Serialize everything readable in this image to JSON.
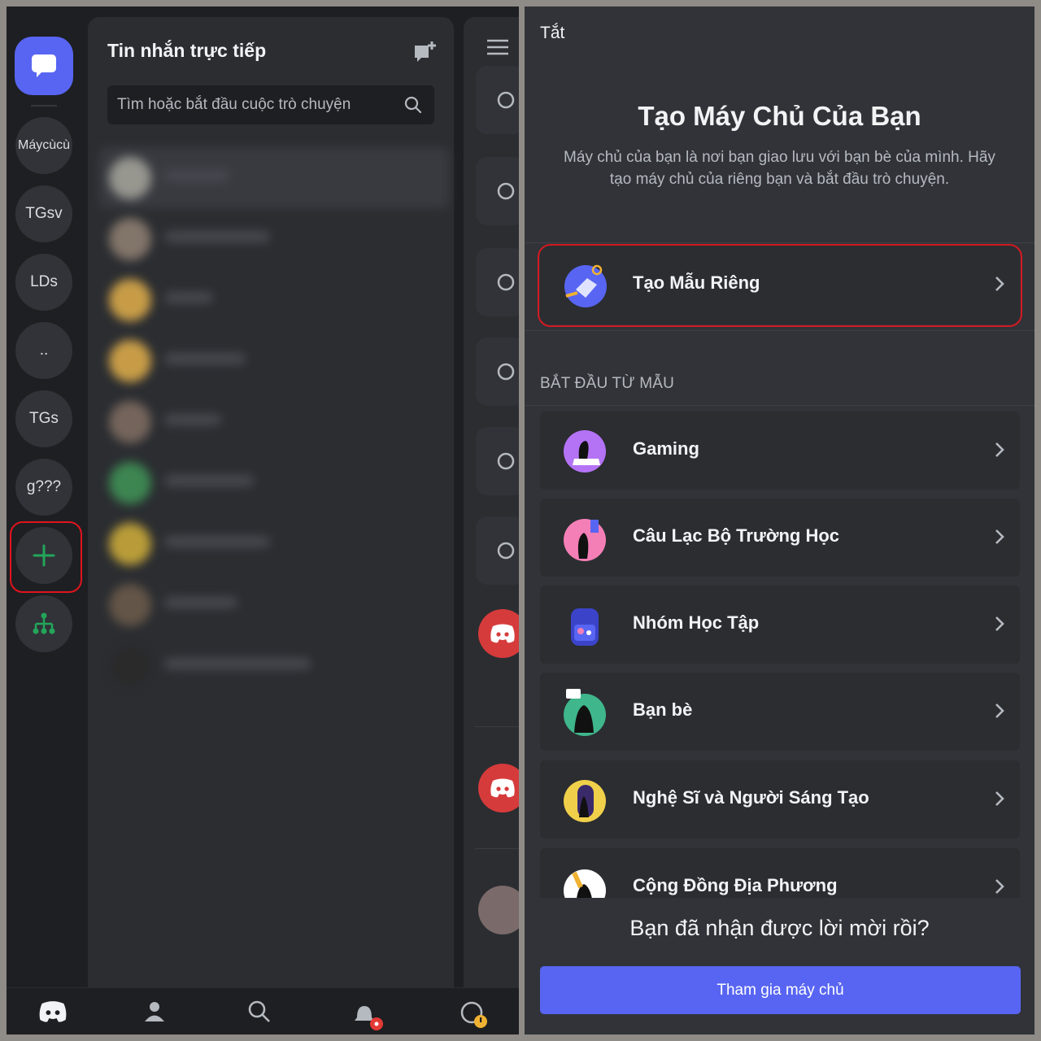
{
  "left": {
    "servers": [
      "Máycùcù",
      "TGsv",
      "LDs",
      "..",
      "TGs",
      "g???"
    ],
    "dm_title": "Tin nhắn trực tiếp",
    "search_placeholder": "Tìm hoặc bắt đầu cuộc trò chuyện",
    "dm_rows_count_note": "blurred"
  },
  "right": {
    "close_label": "Tắt",
    "title": "Tạo Máy Chủ Của Bạn",
    "subtitle": "Máy chủ của bạn là nơi bạn giao lưu với bạn bè của mình. Hãy tạo máy chủ của riêng bạn và bắt đầu trò chuyện.",
    "own_template": "Tạo Mẫu Riêng",
    "section_header": "BẮT ĐẦU TỪ MẪU",
    "templates": [
      {
        "label": "Gaming",
        "icon": "gaming-icon"
      },
      {
        "label": "Câu Lạc Bộ Trường Học",
        "icon": "school-club-icon"
      },
      {
        "label": "Nhóm Học Tập",
        "icon": "study-group-icon"
      },
      {
        "label": "Bạn bè",
        "icon": "friends-icon"
      },
      {
        "label": "Nghệ Sĩ và Người Sáng Tạo",
        "icon": "artists-creators-icon"
      },
      {
        "label": "Cộng Đồng Địa Phương",
        "icon": "local-community-icon"
      }
    ],
    "invite_question": "Bạn đã nhận được lời mời rồi?",
    "join_button": "Tham gia máy chủ"
  },
  "colors": {
    "blurple": "#5865f2",
    "highlight_red": "#e0141e",
    "add_green": "#23a55a"
  }
}
